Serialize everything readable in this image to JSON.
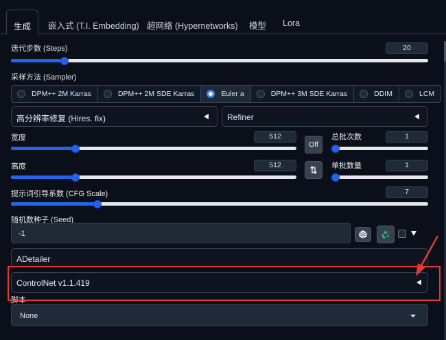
{
  "tabs": [
    {
      "label": "生成"
    },
    {
      "label": "嵌入式 (T.I. Embedding)"
    },
    {
      "label": "超网络 (Hypernetworks)"
    },
    {
      "label": "模型"
    },
    {
      "label": "Lora"
    }
  ],
  "steps": {
    "label": "迭代步数 (Steps)",
    "value": "20",
    "min": 1,
    "max": 150,
    "level": 20
  },
  "sampler": {
    "label": "采样方法 (Sampler)",
    "options": [
      "DPM++ 2M Karras",
      "DPM++ 2M SDE Karras",
      "Euler a",
      "DPM++ 3M SDE Karras",
      "DDIM",
      "LCM"
    ],
    "selected": "Euler a"
  },
  "hires": {
    "label": "高分辨率修复 (Hires. fix)"
  },
  "refiner": {
    "label": "Refiner"
  },
  "width": {
    "label": "宽度",
    "value": "512",
    "min": 64,
    "max": 2048,
    "level": 512
  },
  "height": {
    "label": "高度",
    "value": "512",
    "min": 64,
    "max": 2048,
    "level": 512
  },
  "batch_count": {
    "label": "总批次数",
    "value": "1",
    "min": 1,
    "max": 100,
    "level": 1
  },
  "batch_size": {
    "label": "单批数量",
    "value": "1",
    "min": 1,
    "max": 8,
    "level": 1
  },
  "off_button": {
    "label": "Off"
  },
  "swap_button": {
    "icon": "swap-icon"
  },
  "cfg": {
    "label": "提示词引导系数 (CFG Scale)",
    "value": "7",
    "min": 1,
    "max": 30,
    "level": 7
  },
  "seed": {
    "label": "随机数种子 (Seed)",
    "value": "-1",
    "dice_icon": "dice-icon",
    "recycle_icon": "recycle-icon"
  },
  "adetailer": {
    "label": "ADetailer"
  },
  "controlnet": {
    "label": "ControlNet v1.1.419"
  },
  "script": {
    "label": "脚本",
    "value": "None"
  },
  "colors": {
    "accent": "#2563eb",
    "annotation": "#e53935",
    "background": "#0b0f19"
  }
}
